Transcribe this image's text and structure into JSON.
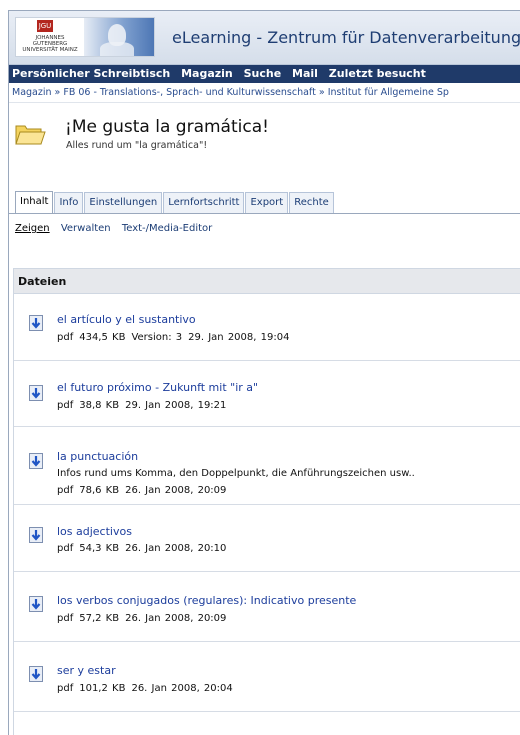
{
  "header": {
    "logo_badge": "JGU",
    "logo_text": "JOHANNES GUTENBERG UNIVERSITÄT MAINZ",
    "site_title": "eLearning - Zentrum für Datenverarbeitung"
  },
  "nav": {
    "items": [
      "Persönlicher Schreibtisch",
      "Magazin",
      "Suche",
      "Mail",
      "Zuletzt besucht"
    ],
    "active": "Magazin"
  },
  "breadcrumb": "Magazin » FB 06 - Translations-, Sprach- und Kulturwissenschaft » Institut für Allgemeine Sp",
  "page": {
    "title": "¡Me gusta la gramática!",
    "subtitle": "Alles rund um \"la gramática\"!",
    "icon": "folder-icon"
  },
  "tabs": [
    "Inhalt",
    "Info",
    "Einstellungen",
    "Lernfortschritt",
    "Export",
    "Rechte"
  ],
  "active_tab": "Inhalt",
  "subtabs": [
    "Zeigen",
    "Verwalten",
    "Text-/Media-Editor"
  ],
  "active_subtab": "Zeigen",
  "files": {
    "header": "Dateien",
    "items": [
      {
        "title": "el artículo y el sustantivo",
        "desc": "",
        "type": "pdf",
        "size": "434,5 KB",
        "version": "Version: 3",
        "date": "29. Jan 2008, 19:04"
      },
      {
        "title": "el futuro próximo - Zukunft mit \"ir a\"",
        "desc": "",
        "type": "pdf",
        "size": "38,8 KB",
        "version": "",
        "date": "29. Jan 2008, 19:21"
      },
      {
        "title": "la punctuación",
        "desc": "Infos rund ums Komma, den Doppelpunkt, die Anführungszeichen usw..",
        "type": "pdf",
        "size": "78,6 KB",
        "version": "",
        "date": "26. Jan 2008, 20:09"
      },
      {
        "title": "los adjectivos",
        "desc": "",
        "type": "pdf",
        "size": "54,3 KB",
        "version": "",
        "date": "26. Jan 2008, 20:10"
      },
      {
        "title": "los verbos conjugados (regulares): Indicativo presente",
        "desc": "",
        "type": "pdf",
        "size": "57,2 KB",
        "version": "",
        "date": "26. Jan 2008, 20:09"
      },
      {
        "title": "ser y estar",
        "desc": "",
        "type": "pdf",
        "size": "101,2 KB",
        "version": "",
        "date": "26. Jan 2008, 20:04"
      }
    ]
  },
  "colors": {
    "nav_bg": "#1f3a69",
    "nav_active": "#9ec6ff",
    "link": "#1c3d9c",
    "logo_red": "#b3261e"
  }
}
